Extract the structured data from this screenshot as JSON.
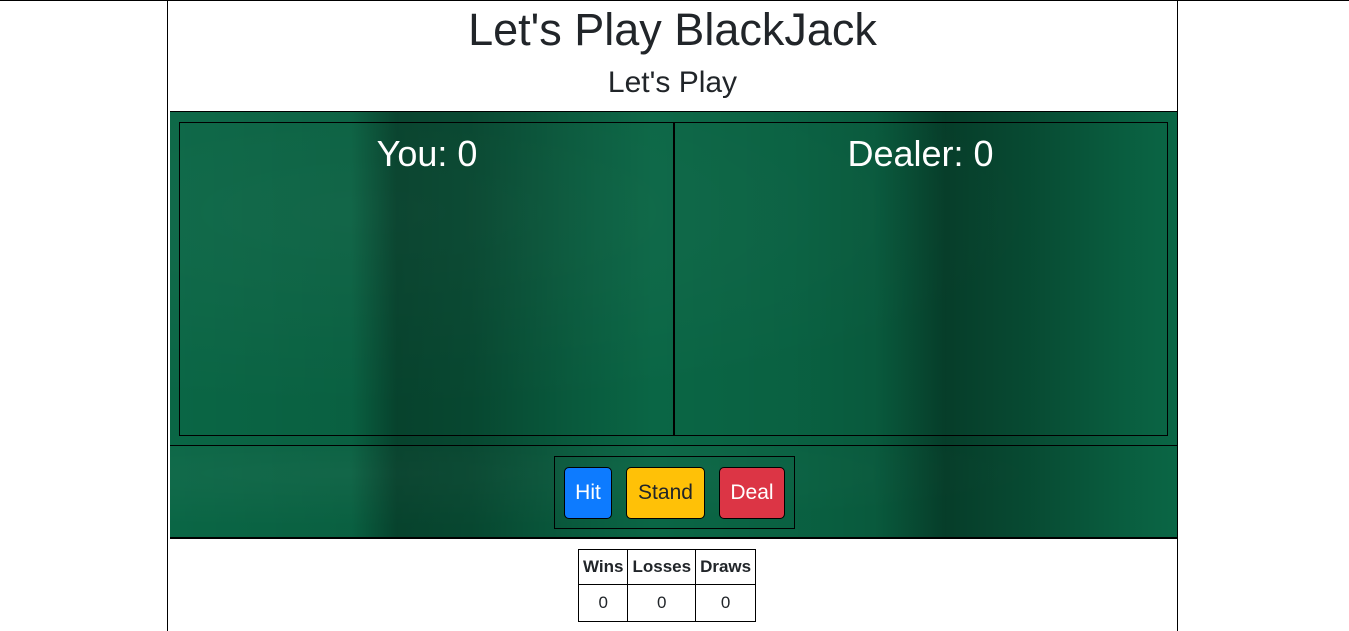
{
  "page": {
    "title": "Let's Play BlackJack",
    "subtitle": "Let's Play"
  },
  "table": {
    "player_label": "You: 0",
    "dealer_label": "Dealer: 0",
    "felt_color": "#0a6645"
  },
  "controls": {
    "hit_label": "Hit",
    "stand_label": "Stand",
    "deal_label": "Deal",
    "hit_color": "#0d7bff",
    "stand_color": "#ffc107",
    "deal_color": "#dc3545"
  },
  "scoreboard": {
    "headers": [
      "Wins",
      "Losses",
      "Draws"
    ],
    "values": [
      "0",
      "0",
      "0"
    ]
  }
}
